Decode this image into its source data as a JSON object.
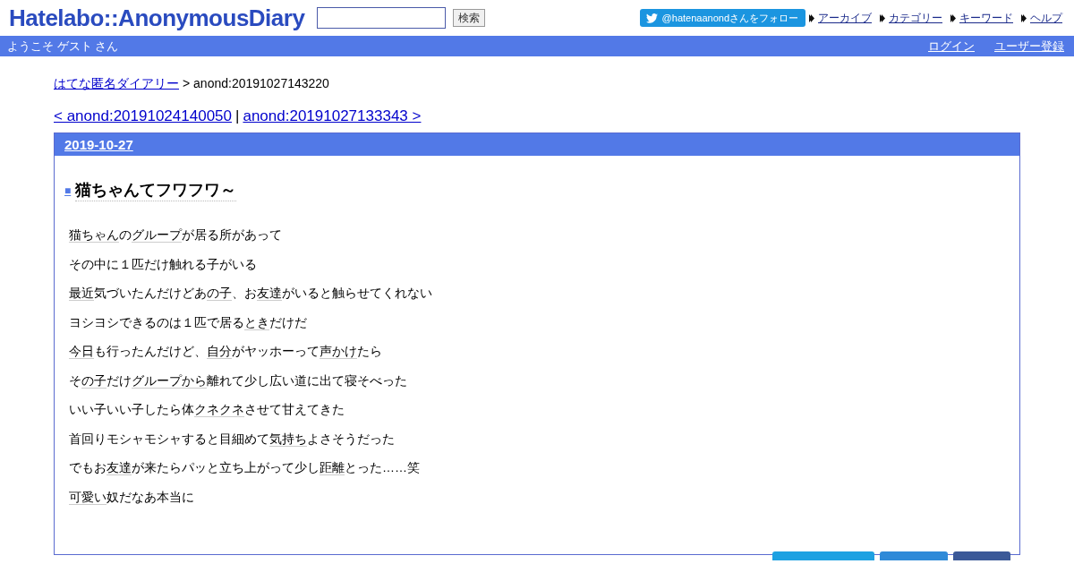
{
  "header": {
    "logo": "Hatelabo::AnonymousDiary",
    "search_button": "検索",
    "follow_button": "@hatenaanondさんをフォロー",
    "nav": [
      "アーカイブ",
      "カテゴリー",
      "キーワード",
      "ヘルプ"
    ]
  },
  "user_bar": {
    "welcome": "ようこそ ゲスト さん",
    "links": [
      "ログイン",
      "ユーザー登録"
    ]
  },
  "breadcrumb": {
    "link": "はてな匿名ダイアリー",
    "current": "> anond:20191027143220"
  },
  "pager": {
    "prev": "< anond:20191024140050",
    "separator": "|",
    "next": "anond:20191027133343 >"
  },
  "day": {
    "date": "2019-10-27",
    "marker": "■",
    "title": "猫ちゃんてフワフワ～",
    "lines": [
      [
        {
          "text": "猫ちゃん",
          "keyword": true
        },
        {
          "text": "の",
          "keyword": false
        },
        {
          "text": "グループ",
          "keyword": true
        },
        {
          "text": "が居る所があって",
          "keyword": false
        }
      ],
      [
        {
          "text": "その中に１匹だけ触れる子がいる",
          "keyword": false
        }
      ],
      [
        {
          "text": "最近",
          "keyword": true
        },
        {
          "text": "気づいたんだけどあ",
          "keyword": false
        },
        {
          "text": "の子",
          "keyword": true
        },
        {
          "text": "、お",
          "keyword": false
        },
        {
          "text": "友達",
          "keyword": true
        },
        {
          "text": "がいると触らせてくれない",
          "keyword": false
        }
      ],
      [
        {
          "text": "ヨシヨシできるのは１匹で居る",
          "keyword": false
        },
        {
          "text": "とき",
          "keyword": true
        },
        {
          "text": "だけだ",
          "keyword": false
        }
      ],
      [
        {
          "text": "今日",
          "keyword": true
        },
        {
          "text": "も行ったんだけど、",
          "keyword": false
        },
        {
          "text": "自分",
          "keyword": true
        },
        {
          "text": "がヤッホーって",
          "keyword": false
        },
        {
          "text": "声かけ",
          "keyword": true
        },
        {
          "text": "たら",
          "keyword": false
        }
      ],
      [
        {
          "text": "そ",
          "keyword": false
        },
        {
          "text": "の子",
          "keyword": true
        },
        {
          "text": "だけ",
          "keyword": false
        },
        {
          "text": "グループから",
          "keyword": true
        },
        {
          "text": "離れて少し広い道に出て寝そべった",
          "keyword": false
        }
      ],
      [
        {
          "text": "いい子いい子したら体",
          "keyword": false
        },
        {
          "text": "クネクネ",
          "keyword": true
        },
        {
          "text": "させて甘えてきた",
          "keyword": false
        }
      ],
      [
        {
          "text": "首回りモシャモシャすると目細めて",
          "keyword": false
        },
        {
          "text": "気持ち",
          "keyword": true
        },
        {
          "text": "よさそうだった",
          "keyword": false
        }
      ],
      [
        {
          "text": "でもお",
          "keyword": false
        },
        {
          "text": "友達",
          "keyword": true
        },
        {
          "text": "が来たらパッと立ち上がって少し",
          "keyword": false
        },
        {
          "text": "距離",
          "keyword": true
        },
        {
          "text": "とった……笑",
          "keyword": false
        }
      ],
      [
        {
          "text": "可愛い",
          "keyword": true
        },
        {
          "text": "奴だなあ本当に",
          "keyword": false
        }
      ]
    ],
    "share_buttons": [
      {
        "color": "#1da1e2"
      },
      {
        "color": "#2f8ad8"
      },
      {
        "color": "#3b5998"
      }
    ]
  }
}
